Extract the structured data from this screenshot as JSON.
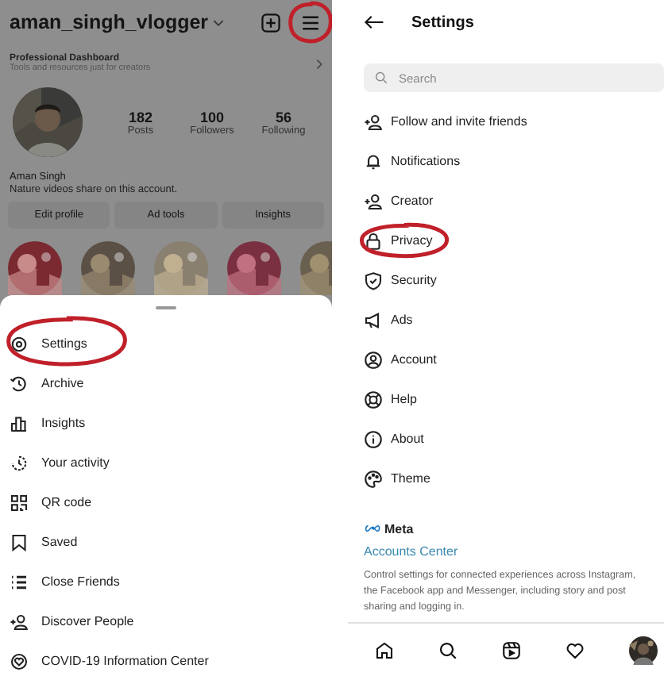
{
  "profile": {
    "username": "aman_singh_vlogger",
    "menu_circled": true,
    "dashboard_title": "Professional Dashboard",
    "dashboard_subtitle": "Tools and resources just for creators",
    "stats": [
      {
        "value": "182",
        "label": "Posts"
      },
      {
        "value": "100",
        "label": "Followers"
      },
      {
        "value": "56",
        "label": "Following"
      }
    ],
    "name": "Aman Singh",
    "bio": "Nature videos share on this account.",
    "buttons": [
      "Edit profile",
      "Ad tools",
      "Insights"
    ]
  },
  "menu": [
    {
      "label": "Settings",
      "circled": true
    },
    {
      "label": "Archive",
      "circled": false
    },
    {
      "label": "Insights",
      "circled": false
    },
    {
      "label": "Your activity",
      "circled": false
    },
    {
      "label": "QR code",
      "circled": false
    },
    {
      "label": "Saved",
      "circled": false
    },
    {
      "label": "Close Friends",
      "circled": false
    },
    {
      "label": "Discover People",
      "circled": false
    },
    {
      "label": "COVID-19 Information Center",
      "circled": false
    }
  ],
  "settings": {
    "title": "Settings",
    "search": {
      "placeholder": "Search"
    },
    "items": [
      {
        "label": "Follow and invite friends",
        "circled": false
      },
      {
        "label": "Notifications",
        "circled": false
      },
      {
        "label": "Creator",
        "circled": false
      },
      {
        "label": "Privacy",
        "circled": true
      },
      {
        "label": "Security",
        "circled": false
      },
      {
        "label": "Ads",
        "circled": false
      },
      {
        "label": "Account",
        "circled": false
      },
      {
        "label": "Help",
        "circled": false
      },
      {
        "label": "About",
        "circled": false
      },
      {
        "label": "Theme",
        "circled": false
      }
    ],
    "meta": "Meta",
    "accounts_center": "Accounts Center",
    "description": "Control settings for connected experiences across Instagram, the Facebook app and Messenger, including story and post sharing and logging in."
  }
}
